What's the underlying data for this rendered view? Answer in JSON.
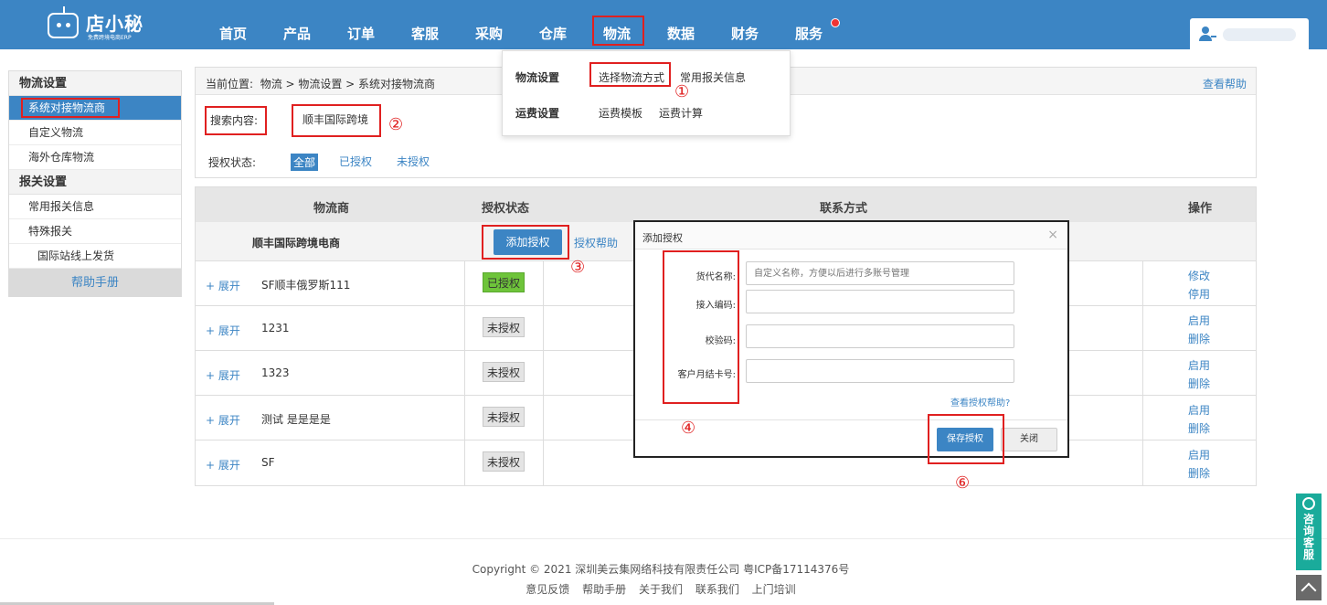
{
  "header": {
    "logo_title": "店小秘",
    "logo_subtitle": "免费跨境电商ERP",
    "nav": [
      "首页",
      "产品",
      "订单",
      "客服",
      "采购",
      "仓库",
      "物流",
      "数据",
      "财务",
      "服务"
    ],
    "user_icon": "user-key-icon"
  },
  "dropdown": {
    "section1_title": "物流设置",
    "section1_links": [
      "选择物流方式",
      "常用报关信息"
    ],
    "section2_title": "运费设置",
    "section2_links": [
      "运费模板",
      "运费计算"
    ]
  },
  "sidebar": {
    "group1": "物流设置",
    "group1_items": [
      "系统对接物流商",
      "自定义物流",
      "海外仓库物流"
    ],
    "group2": "报关设置",
    "group2_items": [
      "常用报关信息",
      "特殊报关"
    ],
    "sub_item": "国际站线上发货",
    "help": "帮助手册"
  },
  "breadcrumb": {
    "prefix": "当前位置:",
    "path": "物流 > 物流设置 > 系统对接物流商",
    "help_link": "查看帮助"
  },
  "search": {
    "label": "搜索内容:",
    "value": "顺丰国际跨境"
  },
  "filter": {
    "label": "授权状态:",
    "options": [
      "全部",
      "已授权",
      "未授权"
    ],
    "selected": "全部"
  },
  "table": {
    "headers": [
      "物流商",
      "授权状态",
      "联系方式",
      "操作"
    ],
    "group_name": "顺丰国际跨境电商",
    "add_button": "添加授权",
    "group_help": "授权帮助",
    "expand_label": "+ 展开",
    "rows": [
      {
        "name": "SF顺丰俄罗斯111",
        "status": "已授权",
        "actions": [
          "修改",
          "停用"
        ]
      },
      {
        "name": "1231",
        "status": "未授权",
        "actions": [
          "启用",
          "删除"
        ]
      },
      {
        "name": "1323",
        "status": "未授权",
        "actions": [
          "启用",
          "删除"
        ]
      },
      {
        "name": "测试 是是是是",
        "status": "未授权",
        "actions": [
          "启用",
          "删除"
        ]
      },
      {
        "name": "SF",
        "status": "未授权",
        "actions": [
          "启用",
          "删除"
        ]
      }
    ]
  },
  "modal": {
    "title": "添加授权",
    "close": "×",
    "fields": [
      {
        "label": "货代名称:",
        "placeholder": "自定义名称，方便以后进行多账号管理"
      },
      {
        "label": "接入编码:",
        "placeholder": ""
      },
      {
        "label": "校验码:",
        "placeholder": ""
      },
      {
        "label": "客户月结卡号:",
        "placeholder": ""
      }
    ],
    "help_link": "查看授权帮助?",
    "save": "保存授权",
    "cancel": "关闭"
  },
  "annotations": [
    "①",
    "②",
    "③",
    "④",
    "⑥"
  ],
  "footer": {
    "copyright": "Copyright  ©  2021 深圳美云集网络科技有限责任公司 粤ICP备17114376号",
    "links": [
      "意见反馈",
      "帮助手册",
      "关于我们",
      "联系我们",
      "上门培训"
    ]
  },
  "side_service": "咨询客服",
  "colors": {
    "primary": "#3c85c4",
    "annotation": "#e02020",
    "authorized": "#6ec43a",
    "service": "#1aab9b"
  }
}
